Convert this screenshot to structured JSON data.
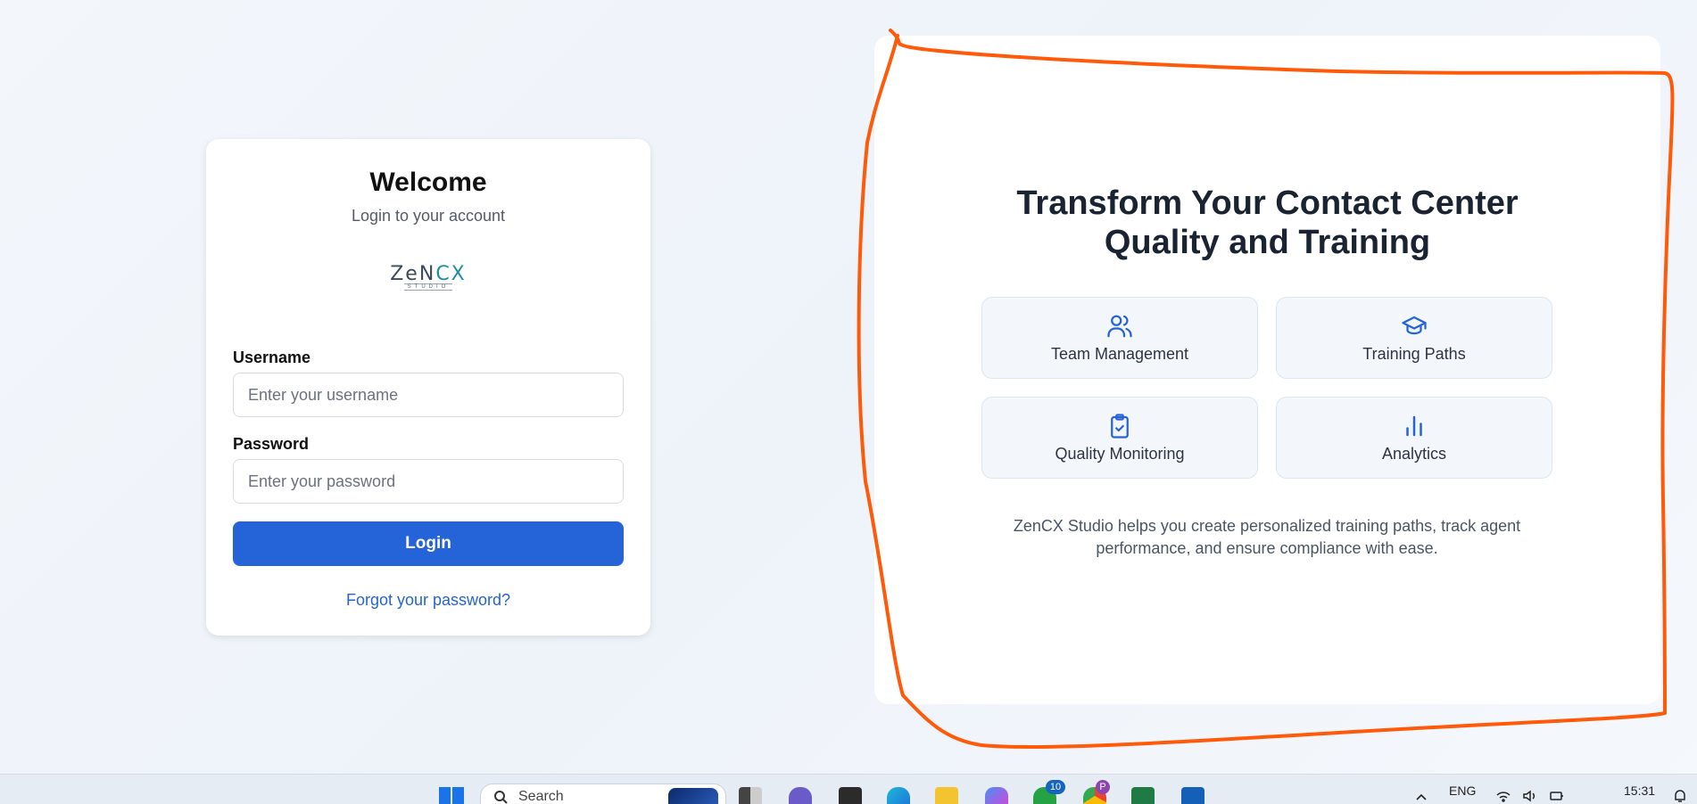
{
  "login": {
    "title": "Welcome",
    "subtitle": "Login to your account",
    "logo_text_1": "ZeN",
    "logo_text_2": "CX",
    "logo_sub": "STUDIO",
    "username_label": "Username",
    "username_placeholder": "Enter your username",
    "password_label": "Password",
    "password_placeholder": "Enter your password",
    "login_button": "Login",
    "forgot_link": "Forgot your password?"
  },
  "promo": {
    "title_line1": "Transform Your Contact Center",
    "title_line2": "Quality and Training",
    "features": [
      {
        "label": "Team Management",
        "icon": "users-icon"
      },
      {
        "label": "Training Paths",
        "icon": "graduation-cap-icon"
      },
      {
        "label": "Quality Monitoring",
        "icon": "clipboard-check-icon"
      },
      {
        "label": "Analytics",
        "icon": "bar-chart-icon"
      }
    ],
    "description": "ZenCX Studio helps you create personalized training paths, track agent performance, and ensure compliance with ease."
  },
  "taskbar": {
    "search_label": "Search",
    "whatsapp_badge": "10",
    "chrome_profile": "P",
    "language": "ENG",
    "time": "15:31"
  },
  "colors": {
    "primary": "#2563d9",
    "annotation": "#ff5a0a",
    "feature_bg": "#f3f7fc"
  }
}
